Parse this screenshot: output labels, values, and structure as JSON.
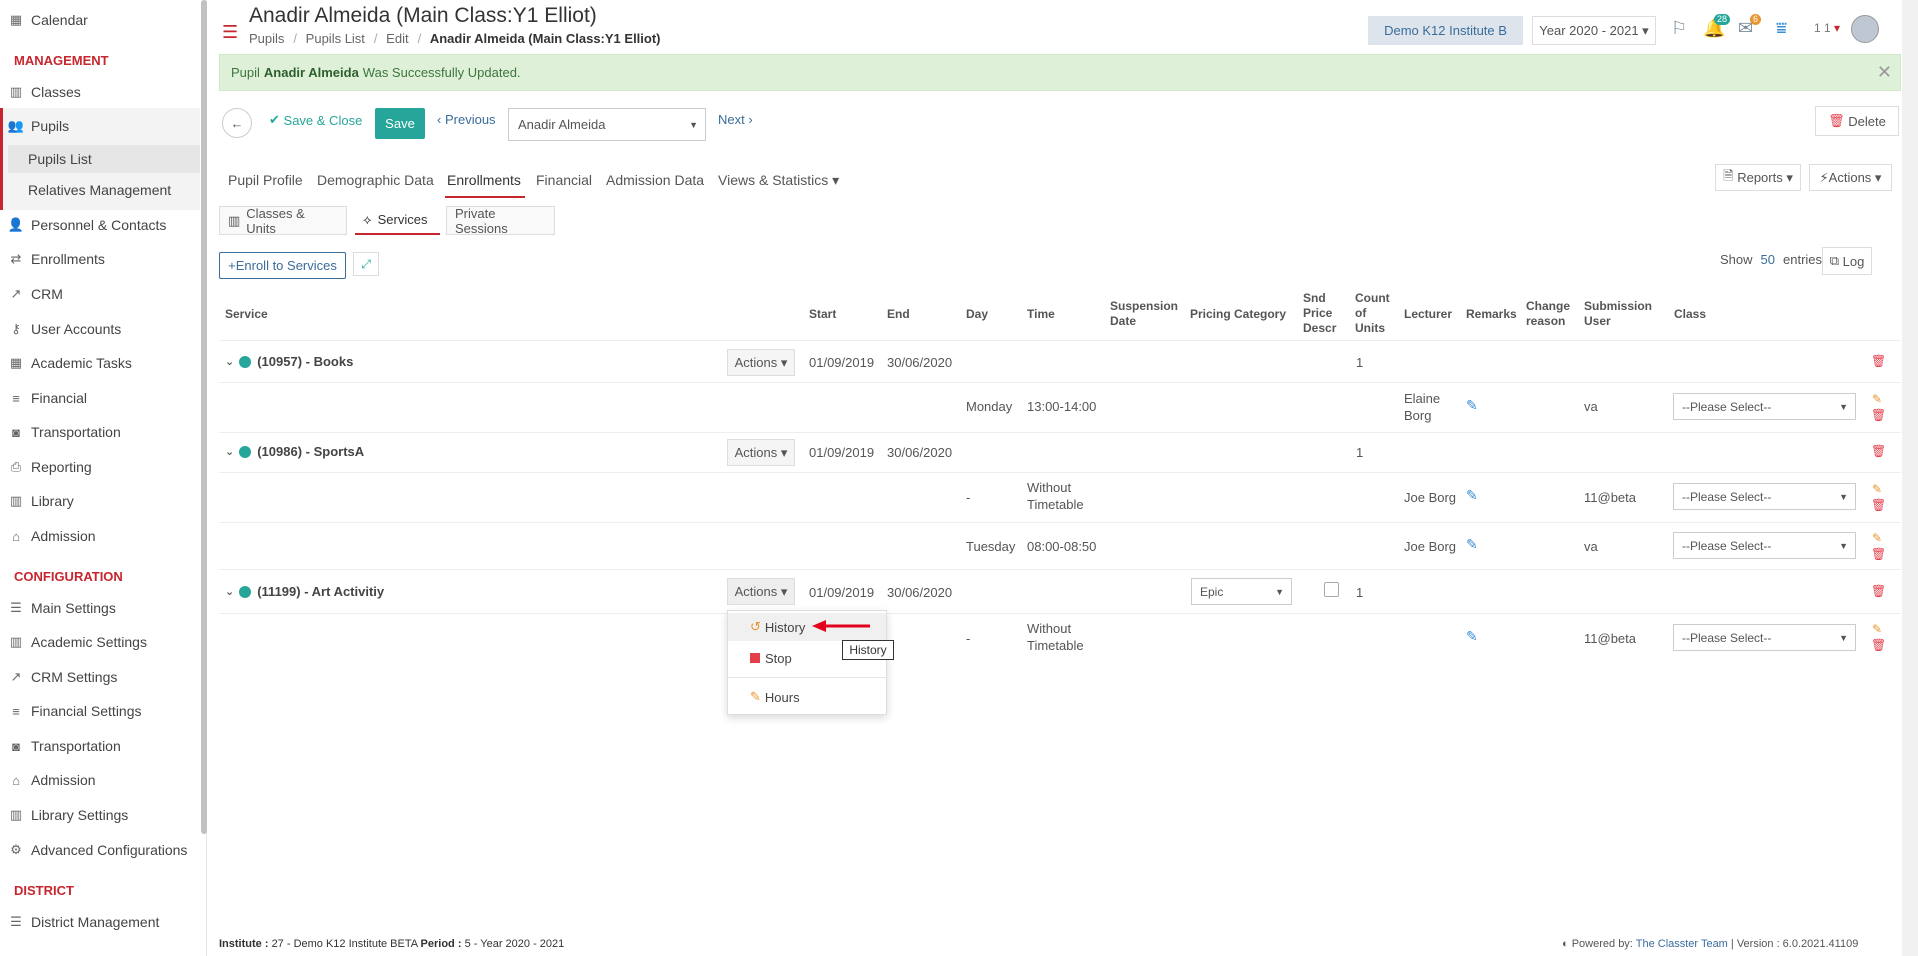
{
  "sidebar": {
    "top_item": "Calendar",
    "management": "MANAGEMENT",
    "classes": "Classes",
    "pupils": "Pupils",
    "pupils_list": "Pupils List",
    "relatives": "Relatives Management",
    "personnel": "Personnel & Contacts",
    "enrollments": "Enrollments",
    "crm": "CRM",
    "user_accounts": "User Accounts",
    "academic_tasks": "Academic Tasks",
    "financial": "Financial",
    "transportation": "Transportation",
    "reporting": "Reporting",
    "library": "Library",
    "admission": "Admission",
    "configuration": "CONFIGURATION",
    "main_settings": "Main Settings",
    "academic_settings": "Academic Settings",
    "crm_settings": "CRM Settings",
    "financial_settings": "Financial Settings",
    "transportation2": "Transportation",
    "admission2": "Admission",
    "library_settings": "Library Settings",
    "advanced": "Advanced Configurations",
    "district": "DISTRICT",
    "district_mgmt": "District Management"
  },
  "header": {
    "title": "Anadir Almeida (Main Class:Y1 Elliot)",
    "crumbs": [
      "Pupils",
      "Pupils List",
      "Edit"
    ],
    "crumb_current": "Anadir Almeida (Main Class:Y1 Elliot)",
    "institute": "Demo K12 Institute B",
    "year": "Year 2020 - 2021",
    "badge_notif": "28",
    "badge_mail": "6",
    "user_short": "1 1"
  },
  "alert": {
    "prefix": "Pupil",
    "name": "Anadir Almeida",
    "suffix": "Was Successfully Updated."
  },
  "toolbar": {
    "save_close": "Save & Close",
    "save": "Save",
    "previous": "Previous",
    "pupil": "Anadir Almeida",
    "next": "Next",
    "delete": "Delete"
  },
  "tabs": [
    "Pupil Profile",
    "Demographic Data",
    "Enrollments",
    "Financial",
    "Admission Data",
    "Views & Statistics"
  ],
  "reports": "Reports",
  "actions": "Actions",
  "subtabs": [
    "Classes & Units",
    "Services",
    "Private Sessions"
  ],
  "enroll_button": "Enroll to Services",
  "show": {
    "label": "Show",
    "value": "50",
    "suffix": "entries",
    "log": "Log"
  },
  "table": {
    "headers": {
      "service": "Service",
      "start": "Start",
      "end": "End",
      "day": "Day",
      "time": "Time",
      "suspension": "Suspension Date",
      "pricing": "Pricing Category",
      "snd": "Snd Price Descr",
      "count": "Count of Units",
      "lecturer": "Lecturer",
      "remarks": "Remarks",
      "change": "Change reason",
      "submission": "Submission User",
      "class": "Class"
    },
    "groups": [
      {
        "name": "(10957) - Books",
        "actions": "Actions",
        "start": "01/09/2019",
        "end": "30/06/2020",
        "count": "1"
      },
      {
        "name": "(10986) - SportsA",
        "actions": "Actions",
        "start": "01/09/2019",
        "end": "30/06/2020",
        "count": "1"
      },
      {
        "name": "(11199) - Art Activitiy",
        "actions": "Actions",
        "start": "01/09/2019",
        "end": "30/06/2020",
        "pricing": "Epic",
        "count": "1"
      }
    ],
    "rows": [
      {
        "day": "Monday",
        "time": "13:00-14:00",
        "lecturer": "Elaine Borg",
        "user": "va",
        "class": "--Please Select--"
      },
      {
        "day": "-",
        "time": "Without Timetable",
        "lecturer": "Joe Borg",
        "user": "11@beta",
        "class": "--Please Select--"
      },
      {
        "day": "Tuesday",
        "time": "08:00-08:50",
        "lecturer": "Joe Borg",
        "user": "va",
        "class": "--Please Select--"
      },
      {
        "day": "-",
        "time": "Without Timetable",
        "lecturer": "",
        "user": "11@beta",
        "class": "--Please Select--"
      }
    ]
  },
  "dropdown": {
    "history": "History",
    "stop": "Stop",
    "hours": "Hours",
    "tooltip": "History"
  },
  "footer": {
    "institute_label": "Institute :",
    "institute_value": "27 - Demo K12 Institute BETA",
    "period_label": "Period :",
    "period_value": "5 - Year 2020 - 2021",
    "powered": "Powered by:",
    "team": "The Classter Team",
    "version": "| Version : 6.0.2021.41109"
  },
  "colors": {
    "accent": "#c8262f",
    "teal": "#26a69a",
    "link": "#3a6d9c"
  }
}
